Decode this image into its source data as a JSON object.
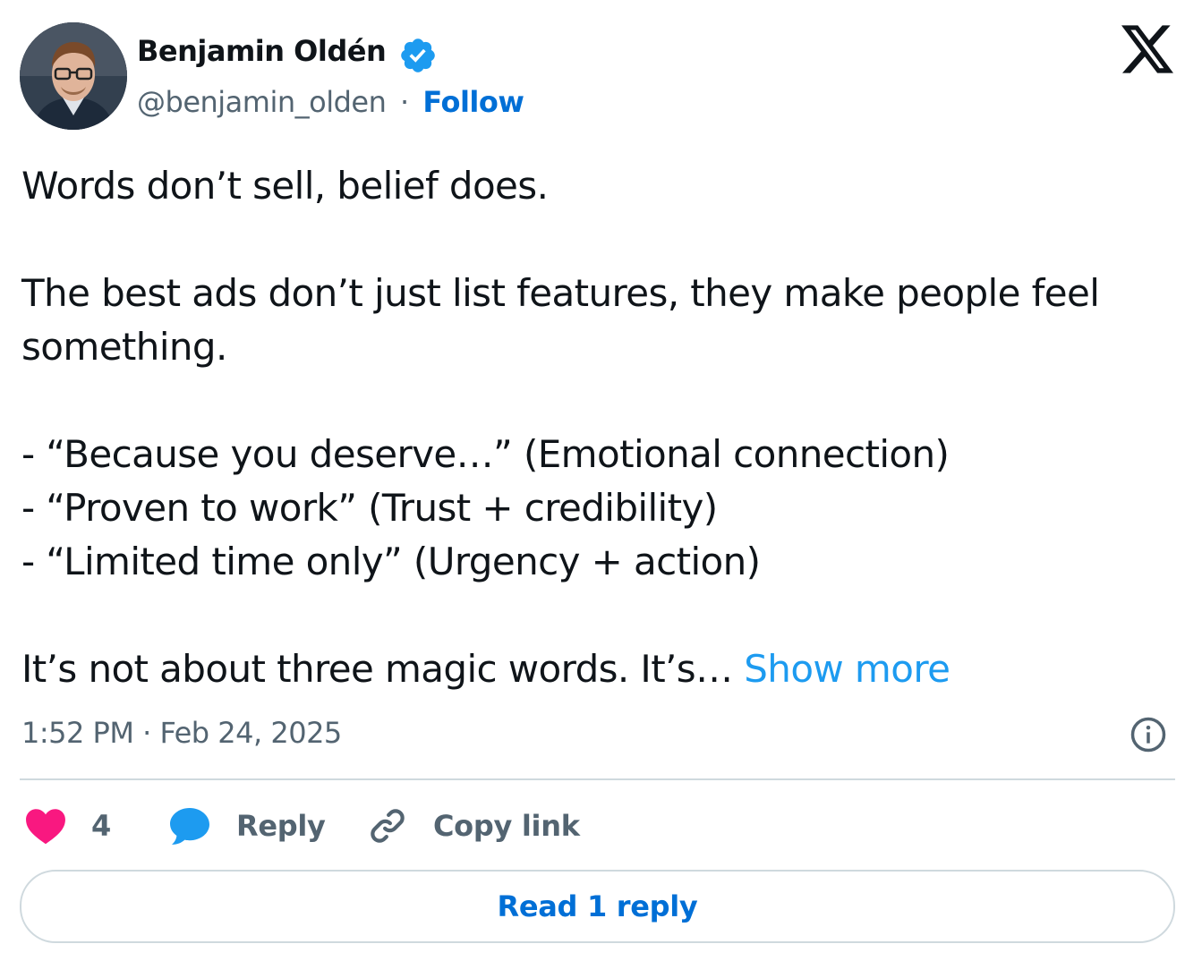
{
  "author": {
    "name": "Benjamin Oldén",
    "handle": "@benjamin_olden",
    "separator": "·",
    "follow_label": "Follow"
  },
  "tweet": {
    "lines": {
      "l1": "Words don’t sell, belief does.",
      "l2": "The best ads don’t just list features, they make people feel",
      "l3": "something.",
      "l4": "- “Because you deserve…” (Emotional connection)",
      "l5": "- “Proven to work” (Trust + credibility)",
      "l6": "- “Limited time only” (Urgency + action)",
      "l7": "It’s not about three magic words. It’s… "
    },
    "show_more_label": "Show more",
    "timestamp": "1:52 PM · Feb 24, 2025"
  },
  "actions": {
    "like_count": "4",
    "reply_label": "Reply",
    "copy_link_label": "Copy link"
  },
  "read_replies_label": "Read 1 reply",
  "icons": {
    "verified": "verified-badge-icon",
    "platform": "x-logo-icon",
    "info": "info-icon",
    "like": "heart-icon",
    "reply": "speech-bubble-icon",
    "copy": "link-icon"
  },
  "colors": {
    "link_blue": "#006fd6",
    "show_more_blue": "#1d9bf0",
    "verified_blue": "#1d9bf0",
    "heart_pink": "#f91880",
    "secondary_text": "#536471",
    "border": "#cfd9de"
  }
}
